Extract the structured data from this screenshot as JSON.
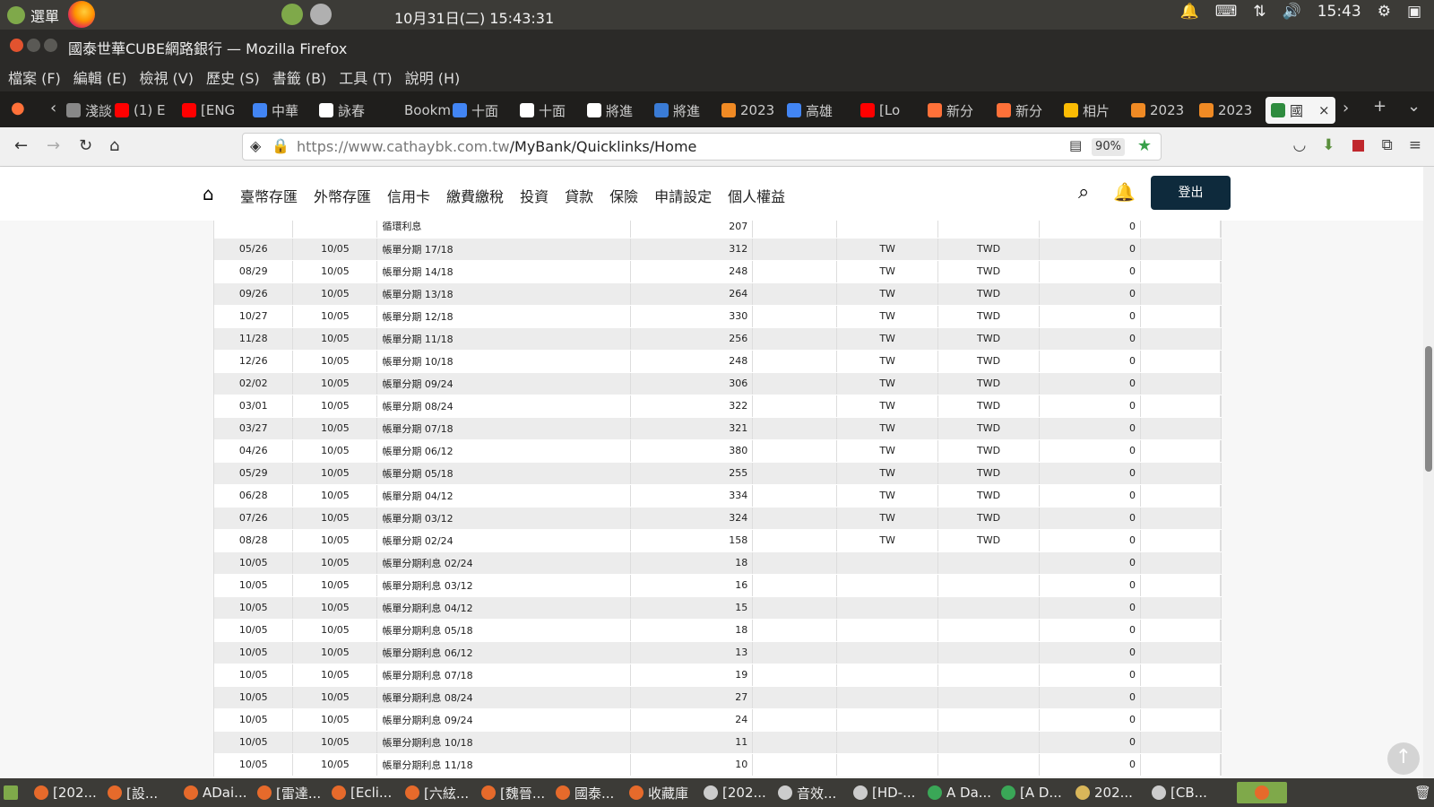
{
  "system": {
    "menu_label": "選單",
    "clock": "10月31日(二) 15:43:31",
    "tray_time": "15:43"
  },
  "window": {
    "title": "國泰世華CUBE網路銀行 — Mozilla Firefox"
  },
  "menubar": [
    "檔案 (F)",
    "編輯 (E)",
    "檢視 (V)",
    "歷史 (S)",
    "書籤 (B)",
    "工具 (T)",
    "說明 (H)"
  ],
  "tabs": [
    {
      "label": "淺談",
      "color": "#888888"
    },
    {
      "label": "(1) E",
      "color": "#ff0000"
    },
    {
      "label": "[ENG",
      "color": "#ff0000"
    },
    {
      "label": "中華",
      "color": "#4285f4"
    },
    {
      "label": "詠春",
      "color": "#ffffff"
    },
    {
      "label": "Bookm",
      "color": "#1f1e1c"
    },
    {
      "label": "十面",
      "color": "#4285f4"
    },
    {
      "label": "十面",
      "color": "#ffffff"
    },
    {
      "label": "將進",
      "color": "#ffffff"
    },
    {
      "label": "將進",
      "color": "#3a7bd5"
    },
    {
      "label": "2023",
      "color": "#f08a24"
    },
    {
      "label": "高雄",
      "color": "#4285f4"
    },
    {
      "label": "[Lo",
      "color": "#ff0000"
    },
    {
      "label": "新分",
      "color": "#ff7139"
    },
    {
      "label": "新分",
      "color": "#ff7139"
    },
    {
      "label": "相片",
      "color": "#fbbc04"
    },
    {
      "label": "2023",
      "color": "#f08a24"
    },
    {
      "label": "2023",
      "color": "#f08a24"
    },
    {
      "label": "國",
      "color": "#2e8b3e"
    }
  ],
  "navbar": {
    "url_host": "https://www.cathaybk.com.tw",
    "url_path": "/MyBank/Quicklinks/Home",
    "zoom": "90%"
  },
  "site_nav": {
    "items": [
      "臺幣存匯",
      "外幣存匯",
      "信用卡",
      "繳費繳稅",
      "投資",
      "貸款",
      "保險",
      "申請設定",
      "個人權益"
    ],
    "logout": "登出"
  },
  "table": {
    "rows": [
      [
        "",
        "",
        "循環利息",
        "207",
        "",
        "",
        "",
        "0"
      ],
      [
        "05/26",
        "10/05",
        "帳單分期 17/18",
        "312",
        "",
        "TW",
        "TWD",
        "0"
      ],
      [
        "08/29",
        "10/05",
        "帳單分期 14/18",
        "248",
        "",
        "TW",
        "TWD",
        "0"
      ],
      [
        "09/26",
        "10/05",
        "帳單分期 13/18",
        "264",
        "",
        "TW",
        "TWD",
        "0"
      ],
      [
        "10/27",
        "10/05",
        "帳單分期 12/18",
        "330",
        "",
        "TW",
        "TWD",
        "0"
      ],
      [
        "11/28",
        "10/05",
        "帳單分期 11/18",
        "256",
        "",
        "TW",
        "TWD",
        "0"
      ],
      [
        "12/26",
        "10/05",
        "帳單分期 10/18",
        "248",
        "",
        "TW",
        "TWD",
        "0"
      ],
      [
        "02/02",
        "10/05",
        "帳單分期 09/24",
        "306",
        "",
        "TW",
        "TWD",
        "0"
      ],
      [
        "03/01",
        "10/05",
        "帳單分期 08/24",
        "322",
        "",
        "TW",
        "TWD",
        "0"
      ],
      [
        "03/27",
        "10/05",
        "帳單分期 07/18",
        "321",
        "",
        "TW",
        "TWD",
        "0"
      ],
      [
        "04/26",
        "10/05",
        "帳單分期 06/12",
        "380",
        "",
        "TW",
        "TWD",
        "0"
      ],
      [
        "05/29",
        "10/05",
        "帳單分期 05/18",
        "255",
        "",
        "TW",
        "TWD",
        "0"
      ],
      [
        "06/28",
        "10/05",
        "帳單分期 04/12",
        "334",
        "",
        "TW",
        "TWD",
        "0"
      ],
      [
        "07/26",
        "10/05",
        "帳單分期 03/12",
        "324",
        "",
        "TW",
        "TWD",
        "0"
      ],
      [
        "08/28",
        "10/05",
        "帳單分期 02/24",
        "158",
        "",
        "TW",
        "TWD",
        "0"
      ],
      [
        "10/05",
        "10/05",
        "帳單分期利息 02/24",
        "18",
        "",
        "",
        "",
        "0"
      ],
      [
        "10/05",
        "10/05",
        "帳單分期利息 03/12",
        "16",
        "",
        "",
        "",
        "0"
      ],
      [
        "10/05",
        "10/05",
        "帳單分期利息 04/12",
        "15",
        "",
        "",
        "",
        "0"
      ],
      [
        "10/05",
        "10/05",
        "帳單分期利息 05/18",
        "18",
        "",
        "",
        "",
        "0"
      ],
      [
        "10/05",
        "10/05",
        "帳單分期利息 06/12",
        "13",
        "",
        "",
        "",
        "0"
      ],
      [
        "10/05",
        "10/05",
        "帳單分期利息 07/18",
        "19",
        "",
        "",
        "",
        "0"
      ],
      [
        "10/05",
        "10/05",
        "帳單分期利息 08/24",
        "27",
        "",
        "",
        "",
        "0"
      ],
      [
        "10/05",
        "10/05",
        "帳單分期利息 09/24",
        "24",
        "",
        "",
        "",
        "0"
      ],
      [
        "10/05",
        "10/05",
        "帳單分期利息 10/18",
        "11",
        "",
        "",
        "",
        "0"
      ],
      [
        "10/05",
        "10/05",
        "帳單分期利息 11/18",
        "10",
        "",
        "",
        "",
        "0"
      ]
    ]
  },
  "taskbar": [
    {
      "label": "[202...",
      "color": "#e66a2b"
    },
    {
      "label": "[設...",
      "color": "#e66a2b"
    },
    {
      "label": "ADai...",
      "color": "#e66a2b"
    },
    {
      "label": "[雷達...",
      "color": "#e66a2b"
    },
    {
      "label": "[Ecli...",
      "color": "#e66a2b"
    },
    {
      "label": "[六絃...",
      "color": "#e66a2b"
    },
    {
      "label": "[魏晉...",
      "color": "#e66a2b"
    },
    {
      "label": "國泰...",
      "color": "#e66a2b"
    },
    {
      "label": "收藏庫",
      "color": "#e66a2b"
    },
    {
      "label": "[202...",
      "color": "#cccccc"
    },
    {
      "label": "音效...",
      "color": "#cccccc"
    },
    {
      "label": "[HD-...",
      "color": "#cccccc"
    },
    {
      "label": "A Da...",
      "color": "#3aa757"
    },
    {
      "label": "[A D...",
      "color": "#3aa757"
    },
    {
      "label": "202...",
      "color": "#d9b65a"
    },
    {
      "label": "[CB...",
      "color": "#cccccc"
    }
  ]
}
